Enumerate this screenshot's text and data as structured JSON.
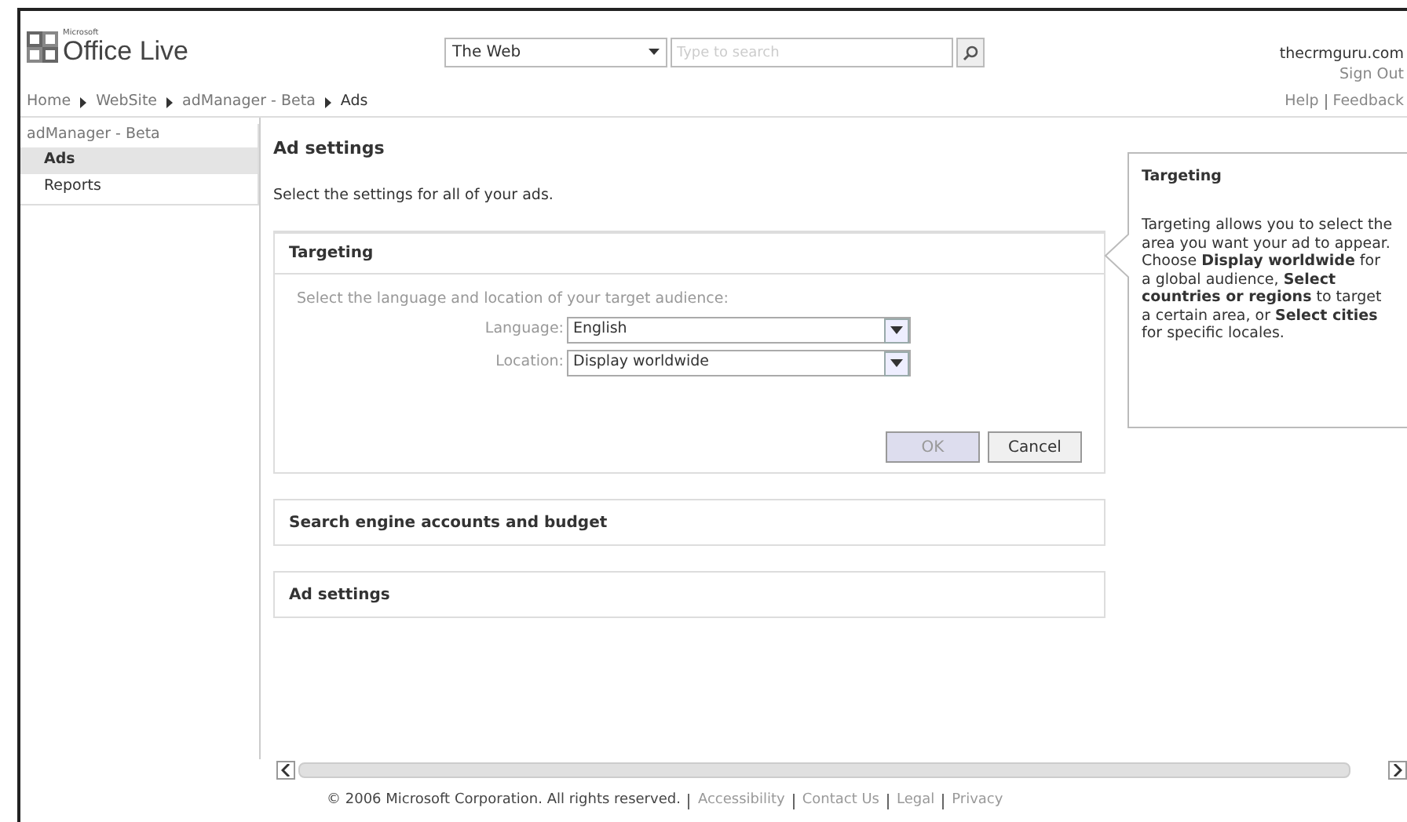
{
  "header": {
    "logo_small": "Microsoft",
    "logo": "Office Live",
    "search_scope": "The Web",
    "search_placeholder": "Type to search",
    "account": "thecrmguru.com",
    "sign_out": "Sign Out",
    "links": [
      "Help",
      "Feedback"
    ]
  },
  "breadcrumbs": [
    "Home",
    "WebSite",
    "adManager - Beta",
    "Ads"
  ],
  "sidebar": {
    "title": "adManager - Beta",
    "items": [
      {
        "label": "Ads",
        "selected": true
      },
      {
        "label": "Reports",
        "selected": false
      }
    ]
  },
  "main": {
    "title": "Ad settings",
    "intro": "Select the settings for all of your ads.",
    "sections": [
      {
        "title": "Targeting",
        "expanded": true,
        "prompt": "Select the language and location of your target audience:",
        "fields": [
          {
            "label": "Language:",
            "value": "English"
          },
          {
            "label": "Location:",
            "value": "Display worldwide"
          }
        ],
        "buttons": [
          "OK",
          "Cancel"
        ]
      },
      {
        "title": "Search engine accounts and budget",
        "expanded": false
      },
      {
        "title": "Ad settings",
        "expanded": false
      }
    ]
  },
  "help": {
    "title": "Targeting",
    "text": "Targeting allows you to select the area you want your ad to appear. Choose **Display worldwide** for a global audience, **Select countries or regions** to target a certain area, or **Select cities** for specific locales."
  },
  "footer": {
    "copyright": "© 2006 Microsoft Corporation. All rights reserved.",
    "links": [
      "Accessibility",
      "Contact Us",
      "Legal",
      "Privacy"
    ]
  }
}
